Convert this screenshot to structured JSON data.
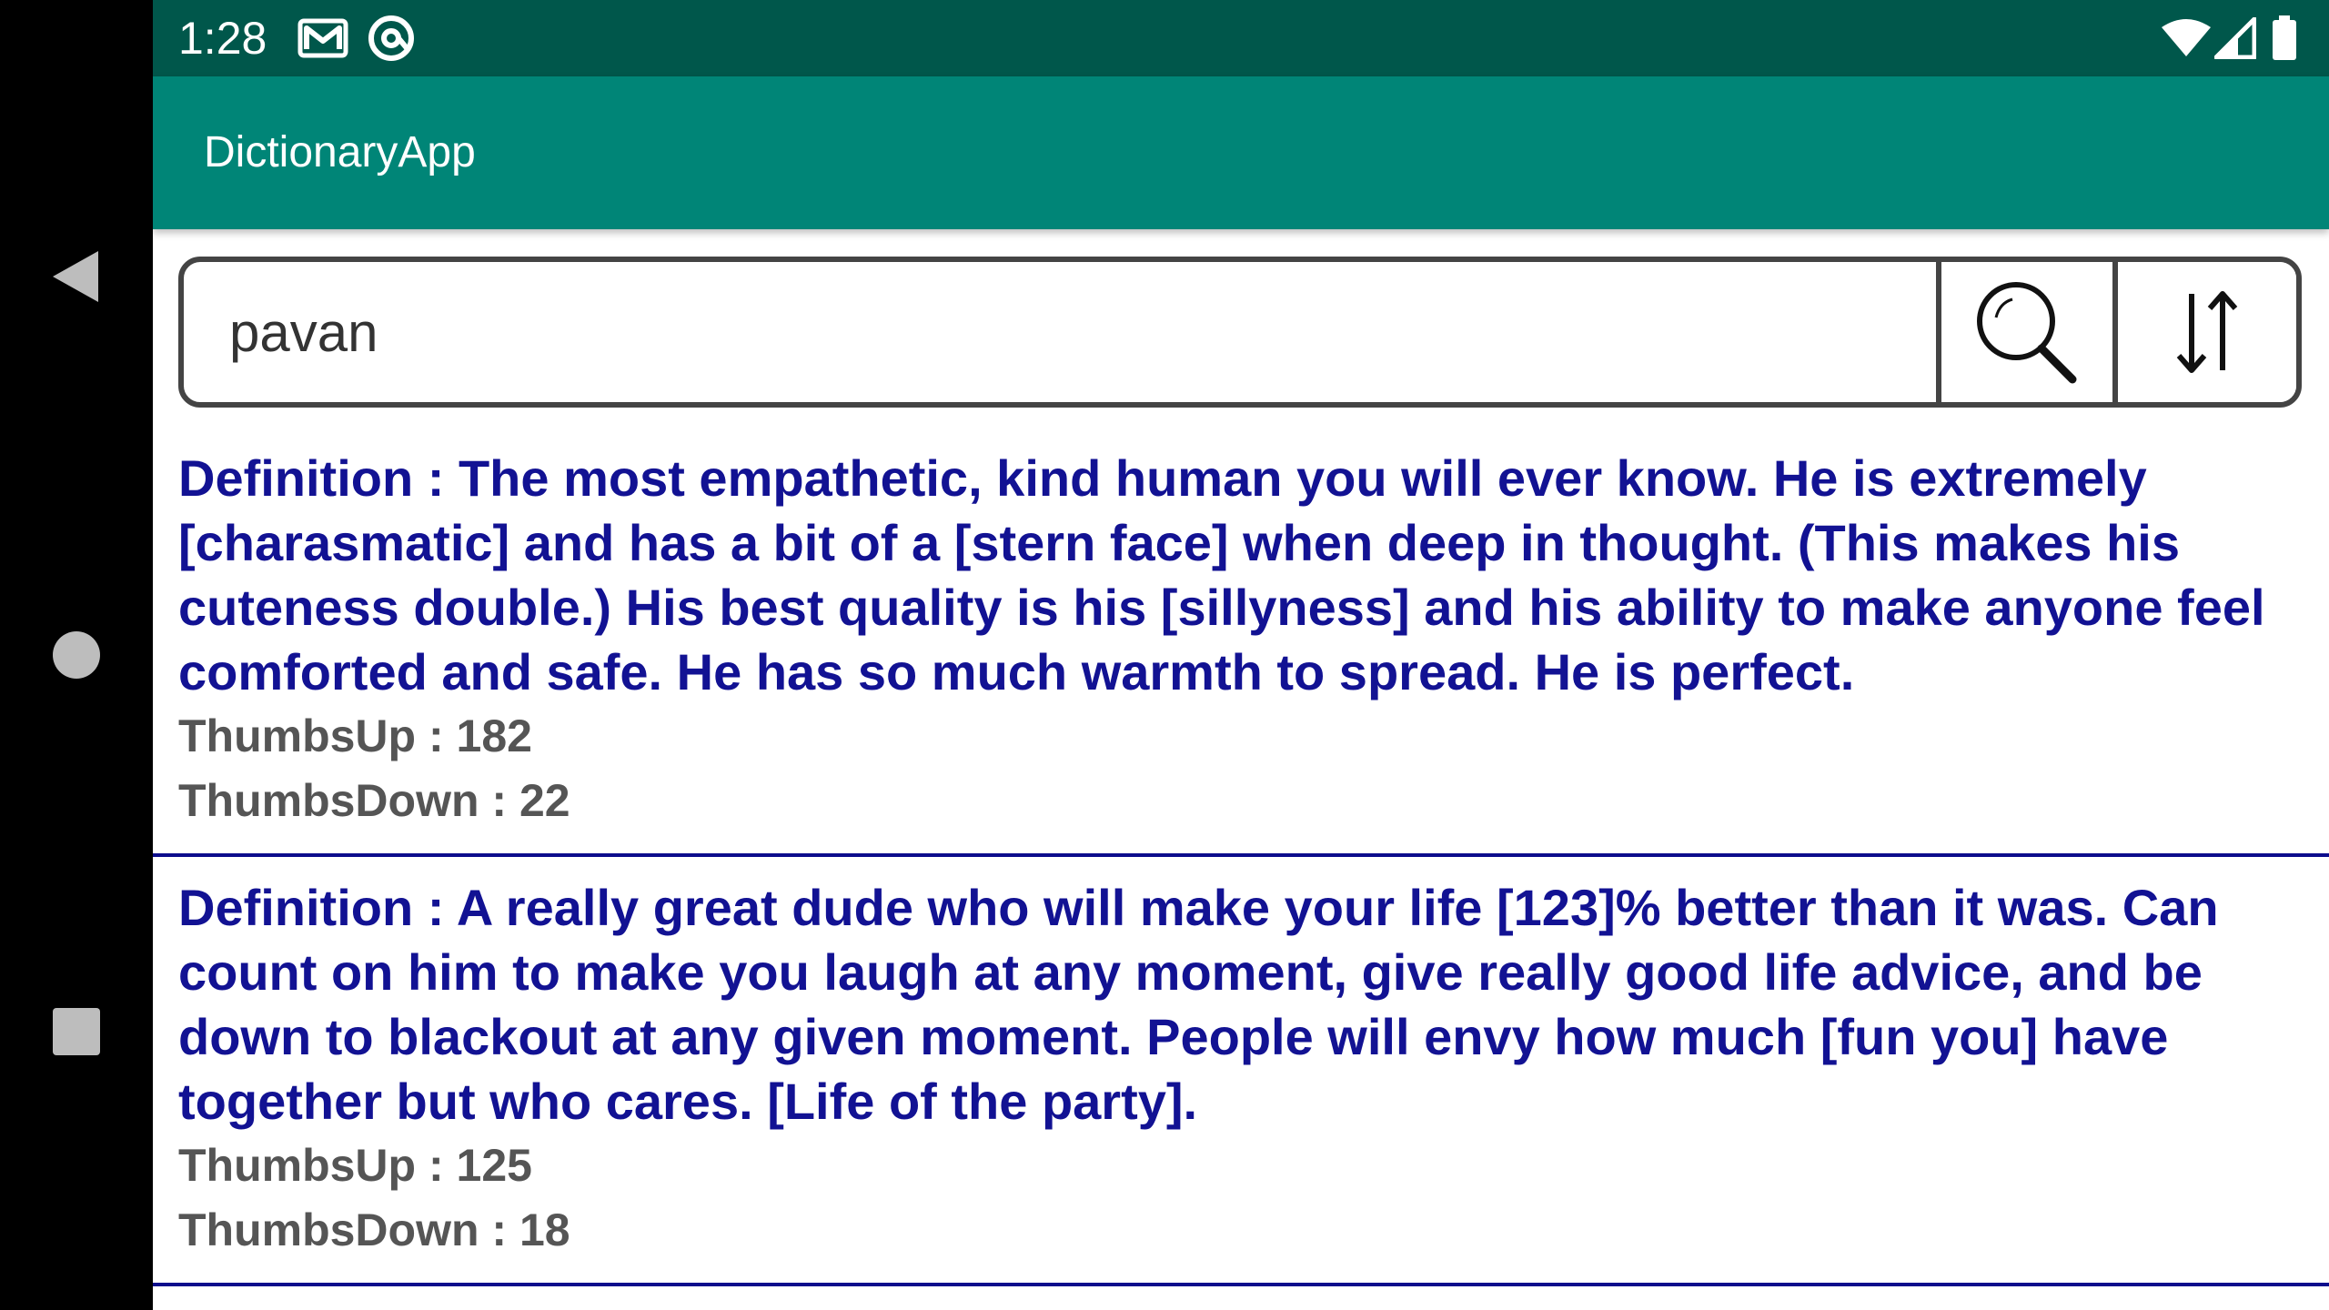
{
  "status_bar": {
    "time": "1:28",
    "icons": [
      "gmail-icon",
      "at-sign-icon",
      "wifi-icon",
      "signal-icon",
      "battery-icon"
    ]
  },
  "app_bar": {
    "title": "DictionaryApp"
  },
  "search": {
    "value": "pavan",
    "search_icon": "search-icon",
    "sort_icon": "sort-icon"
  },
  "results": [
    {
      "definition_label": "Definition : ",
      "definition": "The most empathetic, kind human you will ever know. He is extremely [charasmatic] and has a bit of a [stern face] when deep in thought. (This makes his cuteness double.) His best quality is his [sillyness] and his ability to make anyone feel comforted and safe. He has so much warmth to spread. He is perfect.",
      "thumbs_up": "ThumbsUp : 182",
      "thumbs_down": "ThumbsDown : 22"
    },
    {
      "definition_label": "Definition : ",
      "definition": "A really great dude who will make your life [123]% better than it was. Can count on him to make you laugh at any moment, give really good life advice, and be down to blackout at any given moment. People will envy how much [fun you] have together but who cares. [Life of the party].",
      "thumbs_up": "ThumbsUp : 125",
      "thumbs_down": "ThumbsDown : 18"
    }
  ],
  "nav": {
    "icons": [
      "back-icon",
      "home-icon",
      "recents-icon"
    ]
  },
  "colors": {
    "status_bar": "#00574b",
    "app_bar": "#008577",
    "definition_text": "#121293",
    "stat_text": "#555555",
    "divider": "#0d0d8c"
  }
}
